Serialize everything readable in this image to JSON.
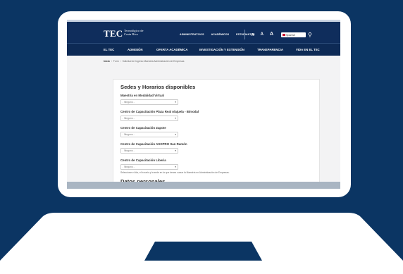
{
  "site": {
    "logo": "TEC",
    "logo_sub": "Tecnológico de Costa Rica",
    "top_nav": [
      "ADMINISTRATIVOS",
      "ACADÉMICOS",
      "ESTUDIANTES"
    ],
    "font_sizes": [
      "A",
      "A",
      "A"
    ],
    "language": "Spanish",
    "main_nav": [
      "EL TEC",
      "ADMISIÓN",
      "OFERTA ACADÉMICA",
      "INVESTIGACIÓN Y EXTENSIÓN",
      "TRANSPARENCIA",
      "VIDA EN EL TEC"
    ]
  },
  "breadcrumb": {
    "home": "Inicio",
    "items": [
      "Form",
      "Solicitud de Ingreso Maestría Administración de Empresas"
    ]
  },
  "form": {
    "title": "Sedes y Horarios disponibles",
    "fields": [
      {
        "label": "Maestría en Modalidad Virtual",
        "value": "- Ninguno -"
      },
      {
        "label": "Centro de Capacitación Plaza Real Alajuela - Bimodal",
        "value": "- Ninguno -"
      },
      {
        "label": "Centro de Capacitación Zapote",
        "value": "- Ninguno -"
      },
      {
        "label": "Centro de Capacitación ASOPRO San Ramón",
        "value": "- Ninguno -"
      },
      {
        "label": "Centro de Capacitación Liberia",
        "value": "- Ninguno -"
      }
    ],
    "help": "Seleccione el día, el horario y la sede en la que desea cursar la Maestría en Administración de Empresas.",
    "next_section": "Datos personales"
  }
}
